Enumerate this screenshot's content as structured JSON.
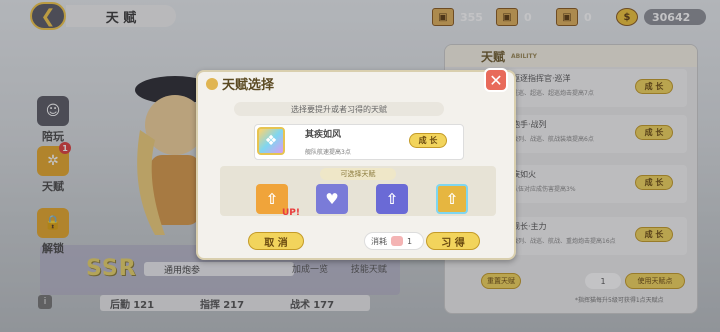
{
  "header": {
    "title": "天 赋"
  },
  "resources": [
    {
      "icon": "chest-icon",
      "value": "355"
    },
    {
      "icon": "box-icon",
      "value": "0"
    },
    {
      "icon": "cat-box-icon",
      "value": "0"
    },
    {
      "icon": "coin-icon",
      "value": "30642"
    }
  ],
  "sidebar": [
    {
      "label": "陪玩",
      "icon": "robot-icon"
    },
    {
      "label": "天赋",
      "icon": "gear-icon",
      "badge": "1"
    },
    {
      "label": "解锁",
      "icon": "lock-icon"
    }
  ],
  "character": {
    "rarity": "SSR",
    "tag": "通用炮参",
    "stats": [
      {
        "label": "后勤",
        "value": "121"
      },
      {
        "label": "指挥",
        "value": "217"
      },
      {
        "label": "战术",
        "value": "177"
      }
    ],
    "bottom_buttons": [
      "加成一览",
      "技能天赋"
    ]
  },
  "panel": {
    "title": "天赋",
    "subtitle": "ABILITY",
    "rows": [
      {
        "name": "驱逐指挥官·巡洋",
        "desc": "重巡、超巡、超巡炮击提高7点",
        "btn": "成 长"
      },
      {
        "name": "炮手·战列",
        "desc": "战列、战巡、航战装填提高6点",
        "btn": "成 长"
      },
      {
        "name": "疾如火",
        "desc": "队伍对应成伤害提高3%",
        "btn": "成 长"
      },
      {
        "name": "舰长·主力",
        "desc": "战列、战巡、航战、重炮炮击提高16点",
        "btn": "成 长"
      }
    ],
    "reset_label": "重置天赋",
    "use_count": "1",
    "use_label": "使用天赋点",
    "footnote": "*指挥猫每升5级可获得1点天赋点"
  },
  "modal": {
    "title": "天赋选择",
    "hint": "选择要提升或者习得的天赋",
    "current": {
      "name": "其疾如风",
      "desc": "舰队航速提高3点",
      "btn": "成 长"
    },
    "choose_label": "可选择天赋",
    "options": [
      {
        "glyph": "⇧",
        "color": "#f0a43a",
        "tag": "UP!"
      },
      {
        "glyph": "♥",
        "color": "#7a7bd8",
        "tag": ""
      },
      {
        "glyph": "⇧",
        "color": "#6a6ad6",
        "tag": ""
      },
      {
        "glyph": "⇧",
        "color": "#e6b640",
        "tag": ""
      }
    ],
    "cancel": "取 消",
    "cost_label": "消耗",
    "cost_value": "1",
    "learn": "习 得"
  }
}
